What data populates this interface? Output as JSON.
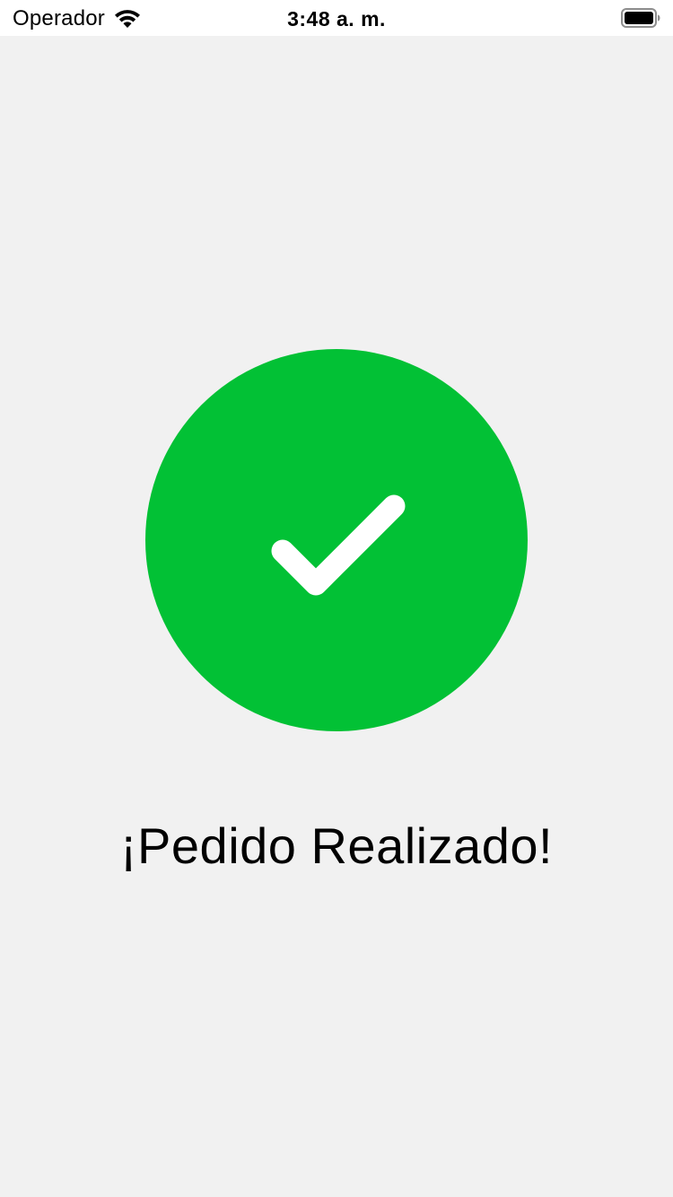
{
  "status_bar": {
    "carrier": "Operador",
    "time": "3:48 a. m.",
    "wifi_icon": "wifi-icon",
    "battery_icon": "battery-icon"
  },
  "success": {
    "icon": "checkmark-icon",
    "circle_color": "#02c135",
    "title": "¡Pedido Realizado!"
  },
  "colors": {
    "background": "#f1f1f1",
    "status_bar": "#ffffff",
    "accent": "#02c135"
  }
}
